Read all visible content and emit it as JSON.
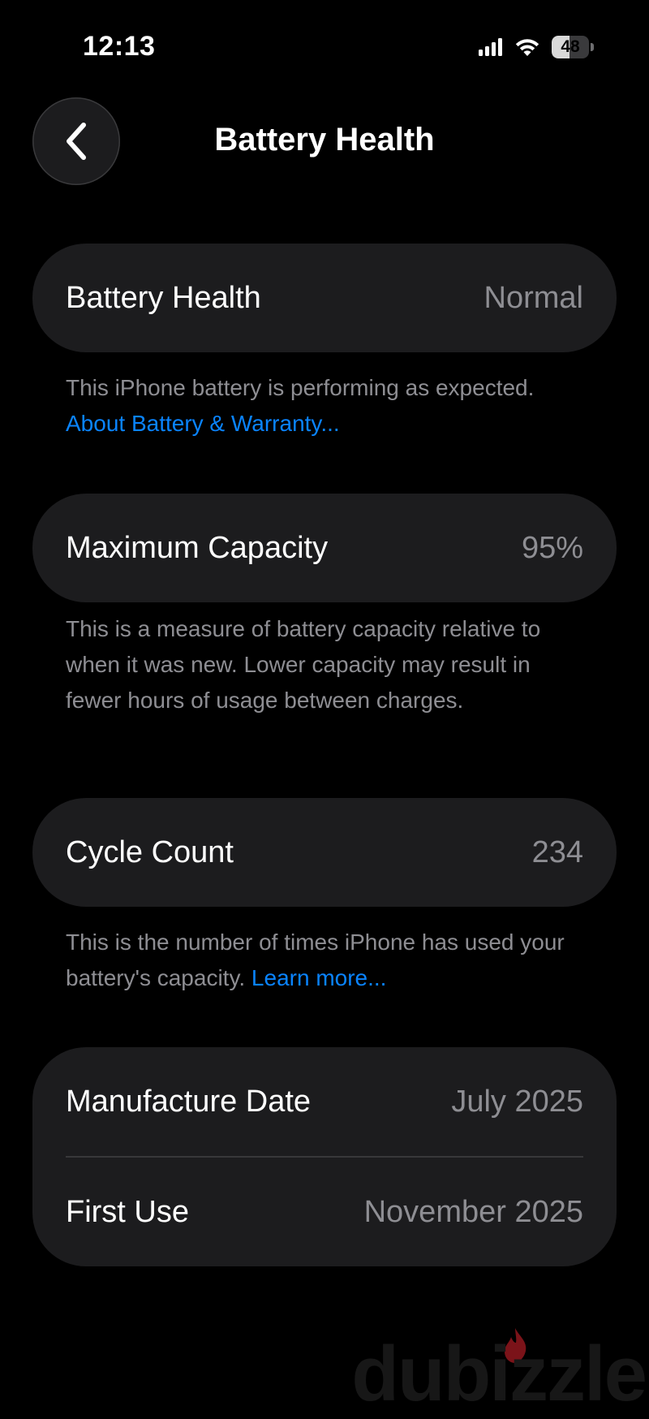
{
  "status_bar": {
    "time": "12:13",
    "battery_level": "48",
    "battery_fraction": 0.48,
    "icons": [
      "signal-icon",
      "wifi-icon",
      "battery-icon"
    ]
  },
  "nav": {
    "back_icon": "chevron-left-icon",
    "title": "Battery Health"
  },
  "battery_health": {
    "label": "Battery Health",
    "value": "Normal",
    "footnote_text": "This iPhone battery is performing as expected. ",
    "footnote_link": "About Battery & Warranty..."
  },
  "maximum_capacity": {
    "label": "Maximum Capacity",
    "value": "95%",
    "footnote_text": "This is a measure of battery capacity relative to when it was new. Lower capacity may result in fewer hours of usage between charges."
  },
  "cycle_count": {
    "label": "Cycle Count",
    "value": "234",
    "footnote_text": "This is the number of times iPhone has used your battery's capacity. ",
    "footnote_link": "Learn more..."
  },
  "dates": {
    "manufacture_label": "Manufacture Date",
    "manufacture_value": "July 2025",
    "first_use_label": "First Use",
    "first_use_value": "November 2025"
  },
  "watermark": {
    "text": "dubizzle"
  },
  "colors": {
    "background": "#000000",
    "card": "#1c1c1e",
    "secondary_text": "#8e8e93",
    "link": "#0a84ff",
    "watermark_flame": "#e0242e"
  }
}
